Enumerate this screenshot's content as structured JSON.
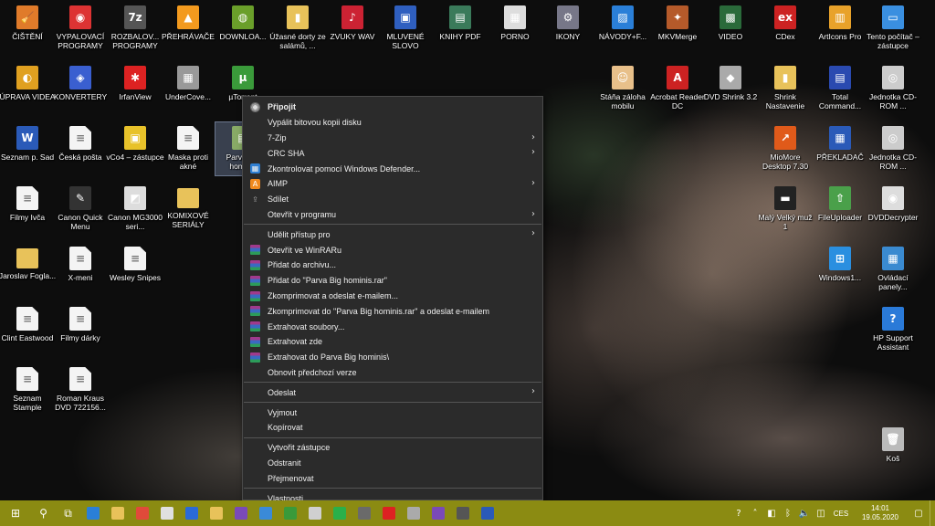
{
  "desktop": {
    "icons": [
      {
        "label": "ČIŠTĚNÍ",
        "color": "#e07b2a",
        "glyph": "🧹"
      },
      {
        "label": "VYPALOVACÍ PROGRAMY",
        "color": "#d33",
        "glyph": "◉"
      },
      {
        "label": "ROZBALOV... PROGRAMY",
        "color": "#555",
        "glyph": "7z"
      },
      {
        "label": "PŘEHRÁVAČE",
        "color": "#f39a1e",
        "glyph": "▲"
      },
      {
        "label": "DOWNLOA...",
        "color": "#6a9f2a",
        "glyph": "◍"
      },
      {
        "label": "Úžasné dorty ze salámů, ...",
        "color": "#e8c25a",
        "glyph": "▮"
      },
      {
        "label": "ZVUKY WAV",
        "color": "#c23",
        "glyph": "♪"
      },
      {
        "label": "MLUVENÉ SLOVO",
        "color": "#2f5fbf",
        "glyph": "▣"
      },
      {
        "label": "KNIHY PDF",
        "color": "#3a7a5a",
        "glyph": "▤"
      },
      {
        "label": "PORNO",
        "color": "#ddd",
        "glyph": "▦"
      },
      {
        "label": "IKONY",
        "color": "#778",
        "glyph": "⚙"
      },
      {
        "label": "NÁVODY+F...",
        "color": "#2a7fd8",
        "glyph": "▨"
      },
      {
        "label": "MKVMerge",
        "color": "#b55a2a",
        "glyph": "✦"
      },
      {
        "label": "VIDEO",
        "color": "#2a6a3a",
        "glyph": "▩"
      },
      {
        "label": "CDex",
        "color": "#c22",
        "glyph": "ex"
      },
      {
        "label": "ArtIcons Pro",
        "color": "#e8a22a",
        "glyph": "▥"
      },
      {
        "label": "Tento počítač – zástupce",
        "color": "#3a8fe0",
        "glyph": "▭"
      },
      {
        "label": "ÚPRAVA VIDEA",
        "color": "#e0a020",
        "glyph": "◐"
      },
      {
        "label": "KONVERTERY",
        "color": "#3a5fd0",
        "glyph": "◈"
      },
      {
        "label": "IrfanView",
        "color": "#d22",
        "glyph": "✱"
      },
      {
        "label": "UnderCove...",
        "color": "#999",
        "glyph": "▦"
      },
      {
        "label": "µTorrent",
        "color": "#3a9a3a",
        "glyph": "µ"
      },
      {
        "label": "Stáňa záloha mobilu",
        "color": "#e8c08a",
        "glyph": "☺"
      },
      {
        "label": "Acrobat Reader DC",
        "color": "#c22",
        "glyph": "A"
      },
      {
        "label": "DVD Shrink 3.2",
        "color": "#aaa",
        "glyph": "◆"
      },
      {
        "label": "Shrink Nastavenie",
        "color": "#e8c25a",
        "glyph": "▮"
      },
      {
        "label": "Total Command...",
        "color": "#2a4ab0",
        "glyph": "▤"
      },
      {
        "label": "Jednotka CD-ROM ...",
        "color": "#ccc",
        "glyph": "◎"
      },
      {
        "label": "Seznam p. Sad",
        "color": "#2a5ab8",
        "glyph": "W"
      },
      {
        "label": "Česká pošta",
        "color": "",
        "glyph": ""
      },
      {
        "label": "vCo4 – zástupce",
        "color": "#e8c22a",
        "glyph": "▣"
      },
      {
        "label": "Maska proti akné",
        "color": "",
        "glyph": ""
      },
      {
        "label": "Parva Big hominis",
        "color": "#8a6",
        "glyph": "▤"
      },
      {
        "label": "MioMore Desktop 7.30",
        "color": "#e05a1a",
        "glyph": "↗"
      },
      {
        "label": "PŘEKLADAČ",
        "color": "#2a5ab8",
        "glyph": "▦"
      },
      {
        "label": "Jednotka CD-ROM ...",
        "color": "#ccc",
        "glyph": "◎"
      },
      {
        "label": "Filmy Ivča",
        "color": "",
        "glyph": ""
      },
      {
        "label": "Canon Quick Menu",
        "color": "#333",
        "glyph": "✎"
      },
      {
        "label": "Canon MG3000 seri...",
        "color": "#ddd",
        "glyph": "◩"
      },
      {
        "label": "KOMIXOVÉ SERIÁLY",
        "color": "",
        "glyph": ""
      },
      {
        "label": "Malý Velký muž 1",
        "color": "#222",
        "glyph": "▬"
      },
      {
        "label": "FileUploader",
        "color": "#4aa04a",
        "glyph": "⇧"
      },
      {
        "label": "DVDDecrypter",
        "color": "#ddd",
        "glyph": "◉"
      },
      {
        "label": "Jaroslav Fogla...",
        "color": "",
        "glyph": ""
      },
      {
        "label": "X-meni",
        "color": "",
        "glyph": ""
      },
      {
        "label": "Wesley Snipes",
        "color": "",
        "glyph": ""
      },
      {
        "label": "Windows1...",
        "color": "#2a8fe0",
        "glyph": "⊞"
      },
      {
        "label": "Ovládací panely...",
        "color": "#3a8ad0",
        "glyph": "▦"
      },
      {
        "label": "Clint Eastwood",
        "color": "",
        "glyph": ""
      },
      {
        "label": "Filmy dárky",
        "color": "",
        "glyph": ""
      },
      {
        "label": "HP Support Assistant",
        "color": "#2a7ad8",
        "glyph": "?"
      },
      {
        "label": "Seznam Stample",
        "color": "",
        "glyph": ""
      },
      {
        "label": "Roman Kraus DVD 722156...",
        "color": "",
        "glyph": ""
      },
      {
        "label": "Koš",
        "color": "#bbb",
        "glyph": "🗑"
      }
    ]
  },
  "context_menu": {
    "items": [
      {
        "type": "item",
        "label": "Připojit",
        "bold": true,
        "icon": "disc-icon",
        "arrow": false
      },
      {
        "type": "item",
        "label": "Vypálit bitovou kopii disku",
        "arrow": false
      },
      {
        "type": "item",
        "label": "7-Zip",
        "arrow": true
      },
      {
        "type": "item",
        "label": "CRC SHA",
        "arrow": true
      },
      {
        "type": "item",
        "label": "Zkontrolovat pomocí Windows Defender...",
        "icon": "shield-icon",
        "arrow": false
      },
      {
        "type": "item",
        "label": "AIMP",
        "icon": "aimp-icon",
        "arrow": true
      },
      {
        "type": "item",
        "label": "Sdílet",
        "icon": "share-icon",
        "arrow": false
      },
      {
        "type": "item",
        "label": "Otevřít v programu",
        "arrow": true
      },
      {
        "type": "sep"
      },
      {
        "type": "item",
        "label": "Udělit přístup pro",
        "arrow": true
      },
      {
        "type": "item",
        "label": "Otevřít ve WinRARu",
        "icon": "winrar-icon",
        "arrow": false
      },
      {
        "type": "item",
        "label": "Přidat do archivu...",
        "icon": "winrar-icon",
        "arrow": false
      },
      {
        "type": "item",
        "label": "Přidat do \"Parva Big hominis.rar\"",
        "icon": "winrar-icon",
        "arrow": false
      },
      {
        "type": "item",
        "label": "Zkomprimovat a odeslat e-mailem...",
        "icon": "winrar-icon",
        "arrow": false
      },
      {
        "type": "item",
        "label": "Zkomprimovat do \"Parva Big hominis.rar\" a odeslat e-mailem",
        "icon": "winrar-icon",
        "arrow": false
      },
      {
        "type": "item",
        "label": "Extrahovat soubory...",
        "icon": "winrar-icon",
        "arrow": false
      },
      {
        "type": "item",
        "label": "Extrahovat zde",
        "icon": "winrar-icon",
        "arrow": false
      },
      {
        "type": "item",
        "label": "Extrahovat do Parva Big hominis\\",
        "icon": "winrar-icon",
        "arrow": false
      },
      {
        "type": "item",
        "label": "Obnovit předchozí verze",
        "arrow": false
      },
      {
        "type": "sep"
      },
      {
        "type": "item",
        "label": "Odeslat",
        "arrow": true
      },
      {
        "type": "sep"
      },
      {
        "type": "item",
        "label": "Vyjmout",
        "arrow": false
      },
      {
        "type": "item",
        "label": "Kopírovat",
        "arrow": false
      },
      {
        "type": "sep"
      },
      {
        "type": "item",
        "label": "Vytvořit zástupce",
        "arrow": false
      },
      {
        "type": "item",
        "label": "Odstranit",
        "arrow": false
      },
      {
        "type": "item",
        "label": "Přejmenovat",
        "arrow": false
      },
      {
        "type": "sep"
      },
      {
        "type": "item",
        "label": "Vlastnosti",
        "arrow": false
      }
    ]
  },
  "annotation": {
    "color": "#e01b1b"
  },
  "taskbar": {
    "color": "#8b8b12",
    "apps": [
      {
        "name": "start-icon",
        "glyph": "⊞"
      },
      {
        "name": "search-icon",
        "glyph": "⚲"
      },
      {
        "name": "task-view-icon",
        "glyph": "⧉"
      },
      {
        "name": "edge-icon",
        "color": "#2a7fd8"
      },
      {
        "name": "explorer-icon",
        "color": "#e8c25a"
      },
      {
        "name": "chrome-icon",
        "color": "#e04a3a"
      },
      {
        "name": "store-icon",
        "color": "#e0e0e0"
      },
      {
        "name": "mail-icon",
        "color": "#2a6ad8"
      },
      {
        "name": "explorer-folder-icon",
        "color": "#e8c25a"
      },
      {
        "name": "download-icon",
        "color": "#7a4ab8"
      },
      {
        "name": "media-icon",
        "color": "#3a8ad8"
      },
      {
        "name": "utorrent-icon",
        "color": "#3a9a3a"
      },
      {
        "name": "app-icon",
        "color": "#d0d0d0"
      },
      {
        "name": "whatsapp-icon",
        "color": "#2ab04a"
      },
      {
        "name": "settings-icon",
        "color": "#6a6a6a"
      },
      {
        "name": "cdex-icon",
        "color": "#d22"
      },
      {
        "name": "app-icon-2",
        "color": "#aaa"
      },
      {
        "name": "downloader-icon",
        "color": "#7a4ab8"
      },
      {
        "name": "app-icon-3",
        "color": "#555"
      },
      {
        "name": "word-icon",
        "color": "#2a5ab8"
      }
    ],
    "tray": {
      "language": "CES",
      "time": "14:01",
      "date": "19.05.2020"
    }
  }
}
